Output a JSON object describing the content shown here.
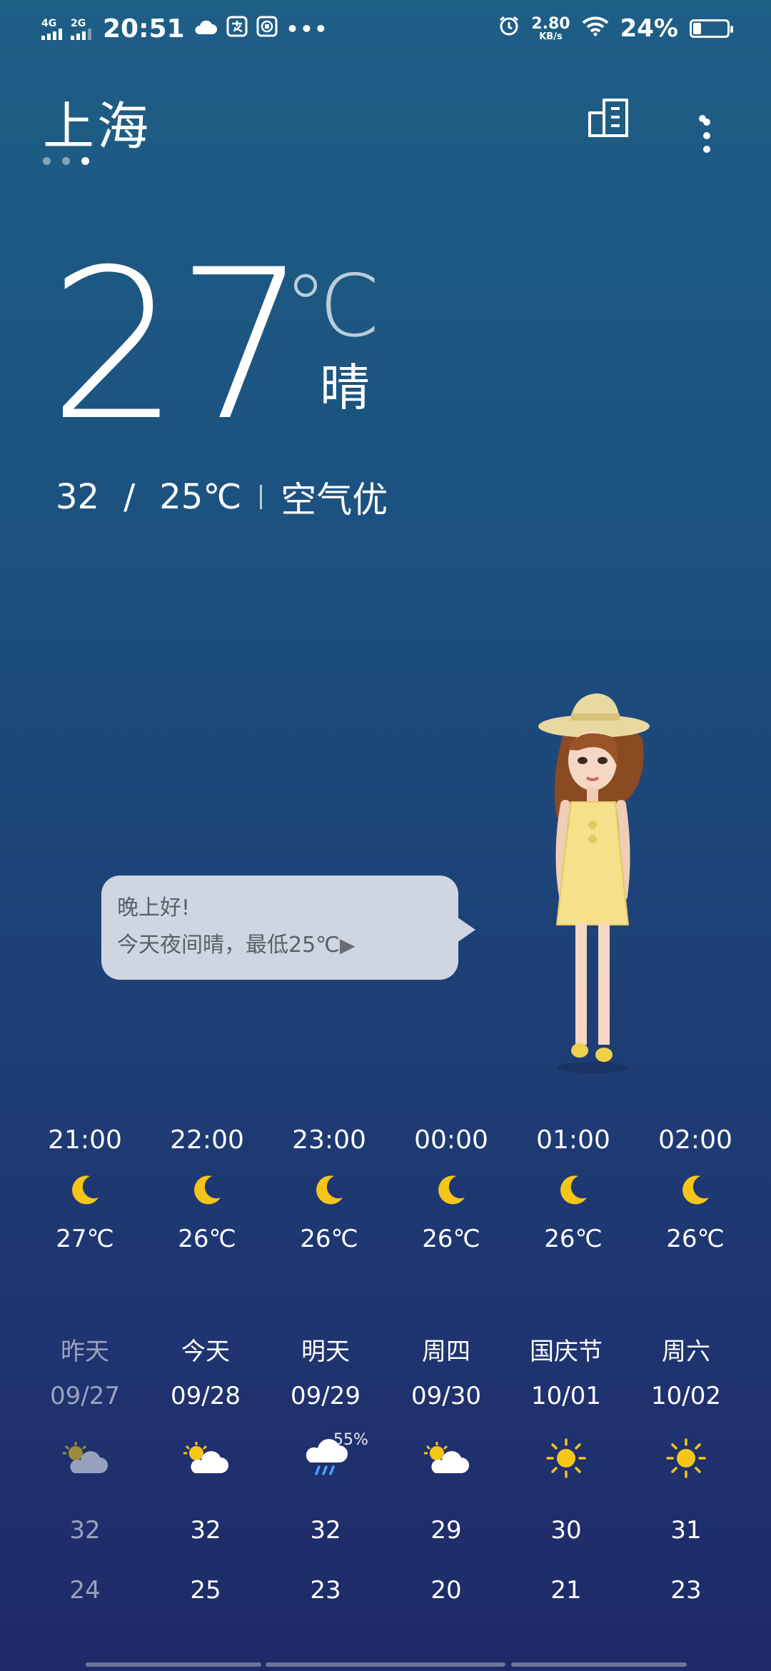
{
  "status_bar": {
    "signal1_label": "4G",
    "signal2_label": "2G",
    "time": "20:51",
    "speed_value": "2.80",
    "speed_unit": "KB/s",
    "battery_text": "24%",
    "battery_level": 0.24,
    "icons": [
      "cloud-icon",
      "alipay-icon",
      "bank-icon",
      "more-notifications-icon",
      "alarm-icon",
      "wifi-icon",
      "battery-icon"
    ]
  },
  "header": {
    "city": "上海",
    "page_count": 3,
    "active_page": 2,
    "icons": [
      "city-manage-icon",
      "more-icon"
    ]
  },
  "current": {
    "temp": "27",
    "unit": "℃",
    "condition": "晴",
    "high": "32",
    "slash": "/",
    "low": "25℃",
    "air_quality": "空气优"
  },
  "bubble": {
    "line1": "晚上好!",
    "line2": "今天夜间晴，最低25℃",
    "play": "▶"
  },
  "hourly": [
    {
      "time": "21:00",
      "icon": "moon-icon",
      "temp": "27℃"
    },
    {
      "time": "22:00",
      "icon": "moon-icon",
      "temp": "26℃"
    },
    {
      "time": "23:00",
      "icon": "moon-icon",
      "temp": "26℃"
    },
    {
      "time": "00:00",
      "icon": "moon-icon",
      "temp": "26℃"
    },
    {
      "time": "01:00",
      "icon": "moon-icon",
      "temp": "26℃"
    },
    {
      "time": "02:00",
      "icon": "moon-icon",
      "temp": "26℃"
    }
  ],
  "daily": [
    {
      "name": "昨天",
      "date": "09/27",
      "icon": "partly-cloudy-icon",
      "pop": "",
      "high": "32",
      "low": "24"
    },
    {
      "name": "今天",
      "date": "09/28",
      "icon": "partly-cloudy-icon",
      "pop": "",
      "high": "32",
      "low": "25"
    },
    {
      "name": "明天",
      "date": "09/29",
      "icon": "rain-icon",
      "pop": "55%",
      "high": "32",
      "low": "23"
    },
    {
      "name": "周四",
      "date": "09/30",
      "icon": "partly-cloudy-icon",
      "pop": "",
      "high": "29",
      "low": "20"
    },
    {
      "name": "国庆节",
      "date": "10/01",
      "icon": "sun-icon",
      "pop": "",
      "high": "30",
      "low": "21"
    },
    {
      "name": "周六",
      "date": "10/02",
      "icon": "sun-icon",
      "pop": "",
      "high": "31",
      "low": "23"
    }
  ],
  "colors": {
    "background_top": "#1e5f86",
    "background_bottom": "#1f2a68",
    "sun": "#f5c518",
    "moon": "#f5c518",
    "cloud": "#ffffff",
    "bubble": "#cfd6e2"
  }
}
